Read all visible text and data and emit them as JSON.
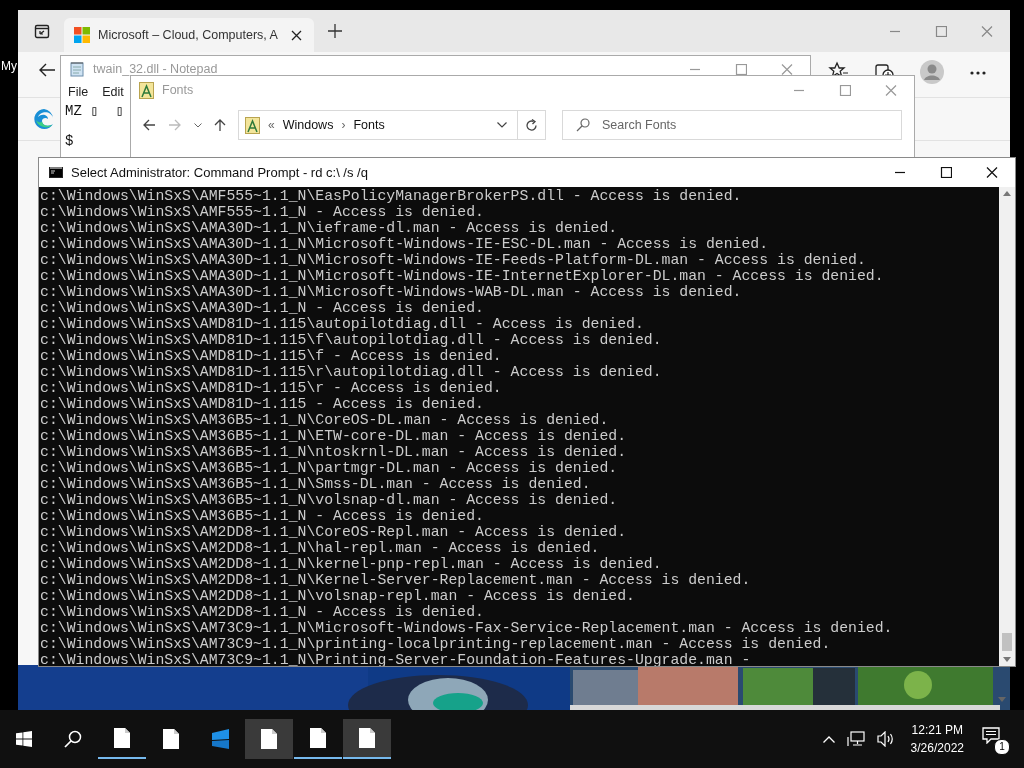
{
  "desktop": {
    "icon_label": "My"
  },
  "browser": {
    "tabs": [
      {
        "title": "Microsoft – Cloud, Computers, A",
        "selected": true
      }
    ]
  },
  "notepad": {
    "title": "twain_32.dll - Notepad",
    "menu": [
      "File",
      "Edit"
    ],
    "lines": [
      "MZ ▯  ▯",
      "$"
    ]
  },
  "explorer": {
    "title": "Fonts",
    "breadcrumb": [
      "«",
      "Windows",
      "›",
      "Fonts"
    ],
    "search": {
      "placeholder": "Search Fonts"
    }
  },
  "console": {
    "title": "Select Administrator: Command Prompt - rd  c:\\ /s /q",
    "lines": [
      "c:\\Windows\\WinSxS\\AMF555~1.1_N\\EasPolicyManagerBrokerPS.dll - Access is denied.",
      "c:\\Windows\\WinSxS\\AMF555~1.1_N - Access is denied.",
      "c:\\Windows\\WinSxS\\AMA30D~1.1_N\\ieframe-dl.man - Access is denied.",
      "c:\\Windows\\WinSxS\\AMA30D~1.1_N\\Microsoft-Windows-IE-ESC-DL.man - Access is denied.",
      "c:\\Windows\\WinSxS\\AMA30D~1.1_N\\Microsoft-Windows-IE-Feeds-Platform-DL.man - Access is denied.",
      "c:\\Windows\\WinSxS\\AMA30D~1.1_N\\Microsoft-Windows-IE-InternetExplorer-DL.man - Access is denied.",
      "c:\\Windows\\WinSxS\\AMA30D~1.1_N\\Microsoft-Windows-WAB-DL.man - Access is denied.",
      "c:\\Windows\\WinSxS\\AMA30D~1.1_N - Access is denied.",
      "c:\\Windows\\WinSxS\\AMD81D~1.115\\autopilotdiag.dll - Access is denied.",
      "c:\\Windows\\WinSxS\\AMD81D~1.115\\f\\autopilotdiag.dll - Access is denied.",
      "c:\\Windows\\WinSxS\\AMD81D~1.115\\f - Access is denied.",
      "c:\\Windows\\WinSxS\\AMD81D~1.115\\r\\autopilotdiag.dll - Access is denied.",
      "c:\\Windows\\WinSxS\\AMD81D~1.115\\r - Access is denied.",
      "c:\\Windows\\WinSxS\\AMD81D~1.115 - Access is denied.",
      "c:\\Windows\\WinSxS\\AM36B5~1.1_N\\CoreOS-DL.man - Access is denied.",
      "c:\\Windows\\WinSxS\\AM36B5~1.1_N\\ETW-core-DL.man - Access is denied.",
      "c:\\Windows\\WinSxS\\AM36B5~1.1_N\\ntoskrnl-DL.man - Access is denied.",
      "c:\\Windows\\WinSxS\\AM36B5~1.1_N\\partmgr-DL.man - Access is denied.",
      "c:\\Windows\\WinSxS\\AM36B5~1.1_N\\Smss-DL.man - Access is denied.",
      "c:\\Windows\\WinSxS\\AM36B5~1.1_N\\volsnap-dl.man - Access is denied.",
      "c:\\Windows\\WinSxS\\AM36B5~1.1_N - Access is denied.",
      "c:\\Windows\\WinSxS\\AM2DD8~1.1_N\\CoreOS-Repl.man - Access is denied.",
      "c:\\Windows\\WinSxS\\AM2DD8~1.1_N\\hal-repl.man - Access is denied.",
      "c:\\Windows\\WinSxS\\AM2DD8~1.1_N\\kernel-pnp-repl.man - Access is denied.",
      "c:\\Windows\\WinSxS\\AM2DD8~1.1_N\\Kernel-Server-Replacement.man - Access is denied.",
      "c:\\Windows\\WinSxS\\AM2DD8~1.1_N\\volsnap-repl.man - Access is denied.",
      "c:\\Windows\\WinSxS\\AM2DD8~1.1_N - Access is denied.",
      "c:\\Windows\\WinSxS\\AM73C9~1.1_N\\Microsoft-Windows-Fax-Service-Replacement.man - Access is denied.",
      "c:\\Windows\\WinSxS\\AM73C9~1.1_N\\printing-localprinting-replacement.man - Access is denied.",
      "c:\\Windows\\WinSxS\\AM73C9~1.1_N\\Printing-Server-Foundation-Features-Upgrade.man -"
    ]
  },
  "taskbar": {
    "items": [
      {
        "kind": "document",
        "active": false,
        "running": true
      },
      {
        "kind": "document",
        "active": false,
        "running": false
      },
      {
        "kind": "app",
        "active": false,
        "running": false
      },
      {
        "kind": "document",
        "active": true,
        "running": false
      },
      {
        "kind": "document",
        "active": false,
        "running": true
      },
      {
        "kind": "document",
        "active": true,
        "running": true
      }
    ],
    "time": "12:21 PM",
    "date": "3/26/2022",
    "notifications": "1"
  }
}
